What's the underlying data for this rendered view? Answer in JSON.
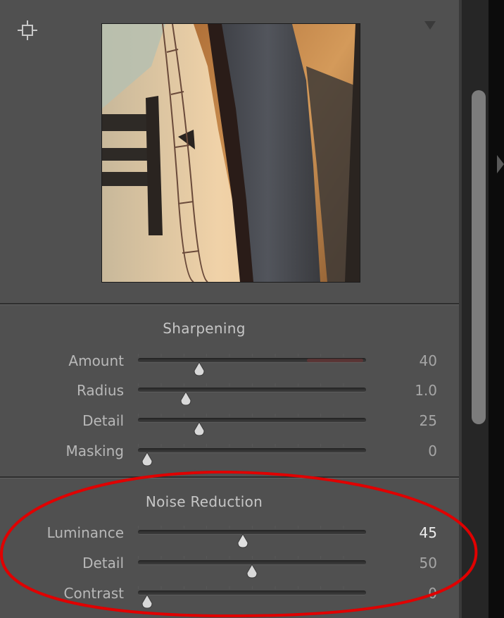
{
  "detail_panel": {
    "sharpening": {
      "title": "Sharpening",
      "sliders": [
        {
          "label": "Amount",
          "value": "40",
          "level": 0.27
        },
        {
          "label": "Radius",
          "value": "1.0",
          "level": 0.21
        },
        {
          "label": "Detail",
          "value": "25",
          "level": 0.27
        },
        {
          "label": "Masking",
          "value": "0",
          "level": 0.04
        }
      ]
    },
    "noise_reduction": {
      "title": "Noise Reduction",
      "sliders": [
        {
          "label": "Luminance",
          "value": "45",
          "level": 0.46,
          "active": true
        },
        {
          "label": "Detail",
          "value": "50",
          "level": 0.5
        },
        {
          "label": "Contrast",
          "value": "0",
          "level": 0.04
        }
      ]
    }
  },
  "colors": {
    "panel": "#505050",
    "annotation": "#e00000",
    "amount_track_accent": "#a03030"
  },
  "icons": {
    "target": "crosshair-icon",
    "disclosure": "triangle-down-icon",
    "collapse": "triangle-right-icon"
  }
}
